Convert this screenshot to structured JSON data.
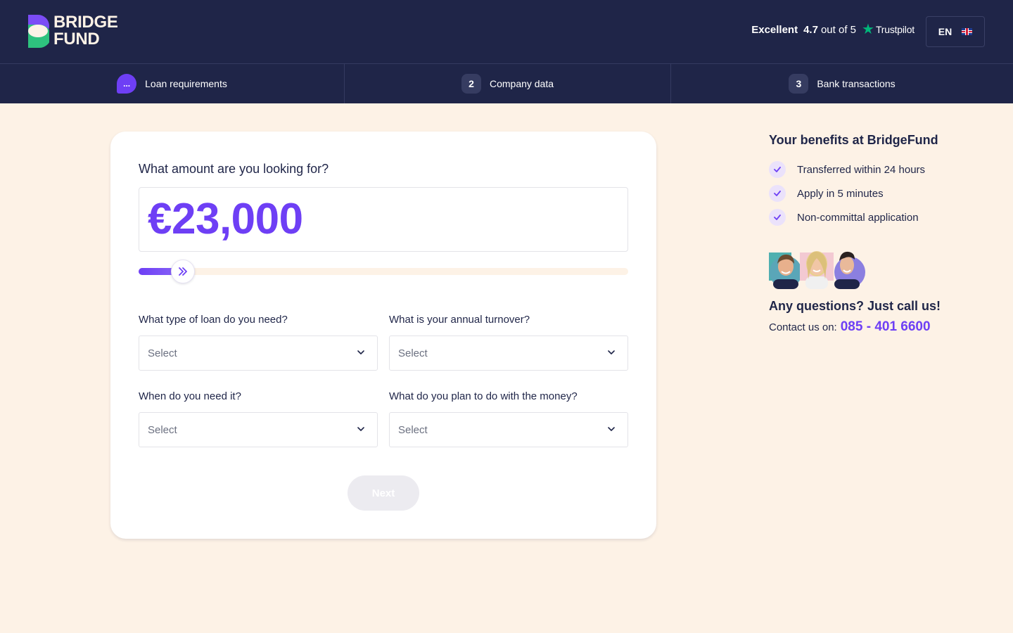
{
  "header": {
    "logo_line1": "BRIDGE",
    "logo_line2": "FUND",
    "trustpilot": {
      "rating_word": "Excellent",
      "score": "4.7",
      "out_of": "out of 5",
      "brand": "Trustpilot"
    },
    "language": "EN"
  },
  "stepper": {
    "steps": [
      {
        "badge": "...",
        "label": "Loan requirements"
      },
      {
        "badge": "2",
        "label": "Company data"
      },
      {
        "badge": "3",
        "label": "Bank transactions"
      }
    ]
  },
  "form": {
    "amount_question": "What amount are you looking for?",
    "amount_value": "€23,000",
    "slider_fraction": 0.09,
    "fields": [
      {
        "label": "What type of loan do you need?",
        "placeholder": "Select"
      },
      {
        "label": "What is your annual turnover?",
        "placeholder": "Select"
      },
      {
        "label": "When do you need it?",
        "placeholder": "Select"
      },
      {
        "label": "What do you plan to do with the money?",
        "placeholder": "Select"
      }
    ],
    "next_label": "Next"
  },
  "sidebar": {
    "title": "Your benefits at BridgeFund",
    "benefits": [
      "Transferred within 24 hours",
      "Apply in 5 minutes",
      "Non-committal application"
    ],
    "question": "Any questions? Just call us!",
    "contact_prefix": "Contact us on:",
    "phone": "085 - 401 6600"
  },
  "colors": {
    "navy": "#1f2548",
    "accent": "#6e3ff5",
    "cream": "#fdf2e6",
    "trustpilot_green": "#00b67a",
    "logo_green": "#2ec27e"
  }
}
